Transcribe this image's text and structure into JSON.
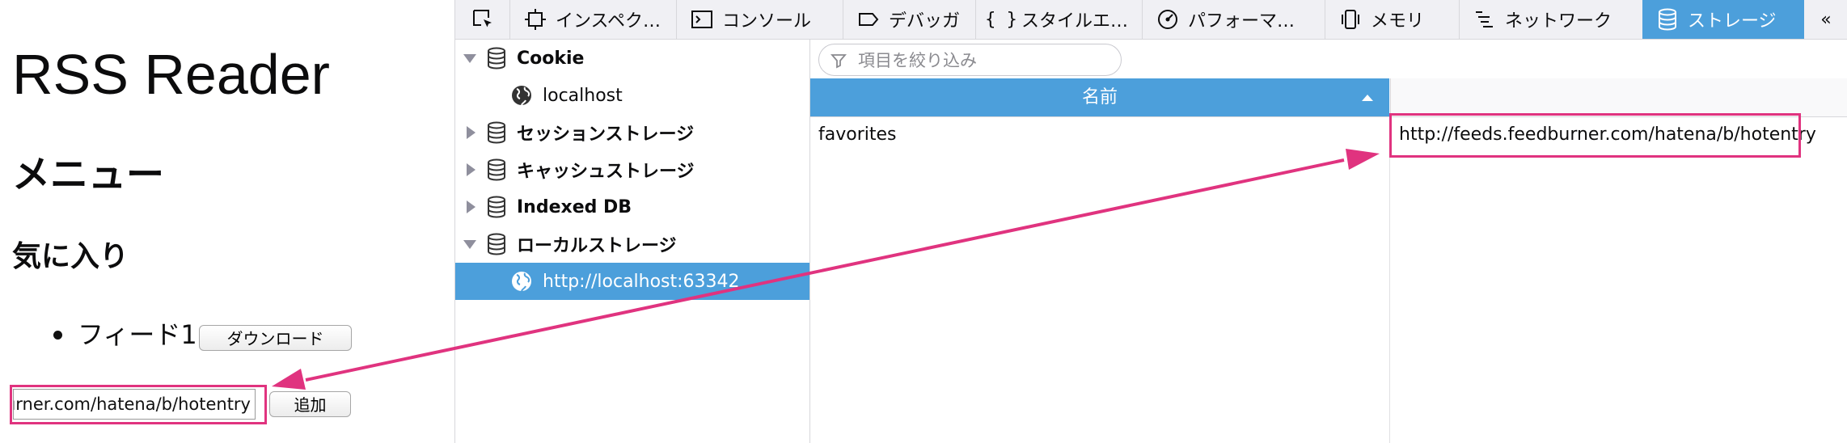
{
  "page": {
    "title": "RSS Reader",
    "menu_heading": "メニュー",
    "favorites_heading": "気に入り",
    "feeds": [
      {
        "label": "フィード1",
        "download_label": "ダウンロード"
      }
    ],
    "url_input_value": "http://feeds.feedburner.com/hatena/b/hotentry",
    "add_label": "追加"
  },
  "devtools": {
    "tabs": [
      {
        "label": "インスペク…",
        "icon": "inspector-icon"
      },
      {
        "label": "コンソール",
        "icon": "console-icon"
      },
      {
        "label": "デバッガ",
        "icon": "debugger-icon"
      },
      {
        "label": "スタイルエ…",
        "icon": "style-editor-icon"
      },
      {
        "label": "パフォーマ…",
        "icon": "performance-icon"
      },
      {
        "label": "メモリ",
        "icon": "memory-icon"
      },
      {
        "label": "ネットワーク",
        "icon": "network-icon"
      },
      {
        "label": "ストレージ",
        "icon": "storage-icon",
        "active": true
      }
    ],
    "tree": {
      "cookie": "Cookie",
      "cookie_host": "localhost",
      "session": "セッションストレージ",
      "cache": "キャッシュストレージ",
      "indexeddb": "Indexed DB",
      "local": "ローカルストレージ",
      "local_host": "http://localhost:63342"
    },
    "filter_placeholder": "項目を絞り込み",
    "table": {
      "name_header": "名前",
      "rows": [
        {
          "name": "favorites",
          "value": "http://feeds.feedburner.com/hatena/b/hotentry"
        }
      ]
    }
  },
  "colors": {
    "accent": "#4c9fdb",
    "highlight": "#e0337f"
  }
}
